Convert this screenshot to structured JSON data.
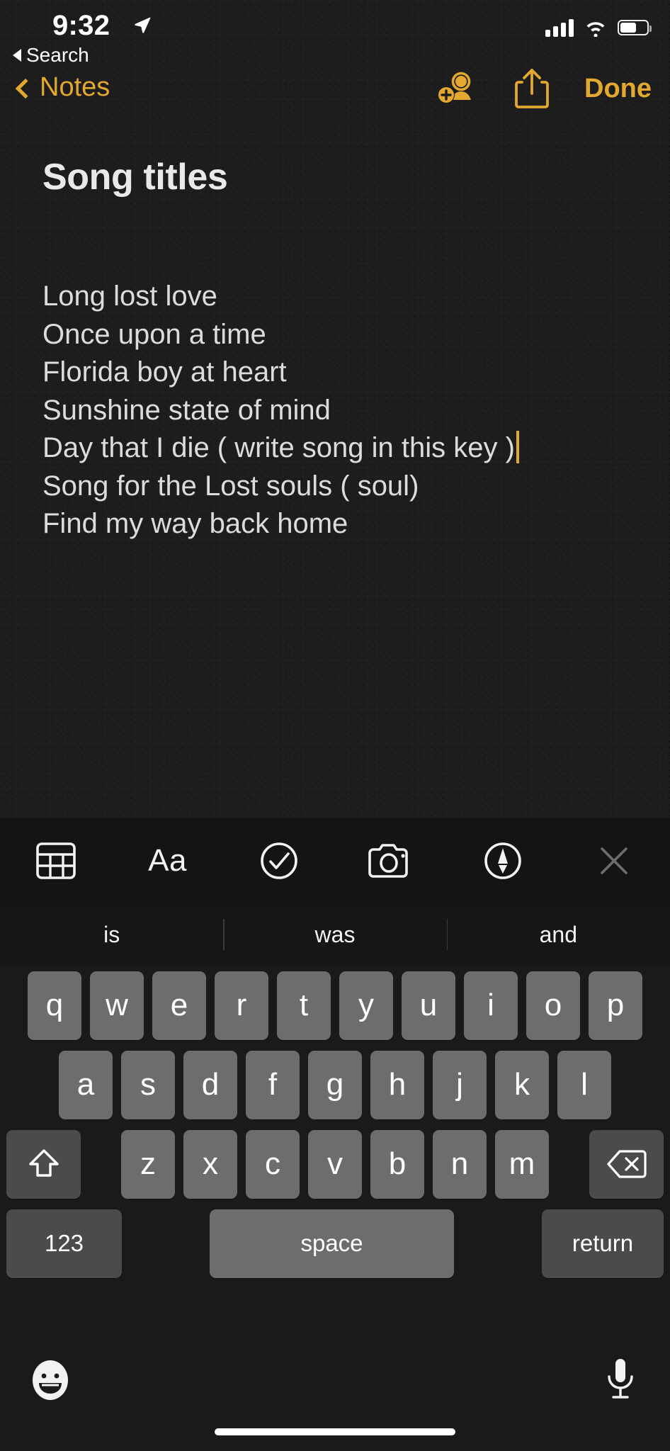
{
  "status_bar": {
    "time": "9:32",
    "location_icon": "location-arrow-icon",
    "cellular_icon": "cellular-signal-icon",
    "wifi_icon": "wifi-icon",
    "battery_icon": "battery-icon",
    "battery_level_pct": 62,
    "back_to_app_label": "Search",
    "back_to_app_icon": "triangle-left-icon"
  },
  "nav_bar": {
    "back_label": "Notes",
    "back_icon": "chevron-left-icon",
    "add_people_icon": "add-person-icon",
    "share_icon": "share-up-arrow-icon",
    "done_label": "Done",
    "accent_color": "#e3a82f"
  },
  "note": {
    "title": "Song titles",
    "lines": [
      "Long lost love",
      "Once upon a time",
      "Florida boy at heart",
      "Sunshine state of mind",
      "Day that I die ( write song in this key )",
      "Song for the Lost souls ( soul)",
      "Find my way back home"
    ],
    "caret_line_index": 4,
    "caret_color": "#e3a82f",
    "text_color": "#dcdcde",
    "background_color": "#1d1d1e"
  },
  "format_toolbar": {
    "items": [
      {
        "name": "table-icon",
        "label": ""
      },
      {
        "name": "format-aa-icon",
        "label": "Aa"
      },
      {
        "name": "checklist-circle-icon",
        "label": ""
      },
      {
        "name": "camera-icon",
        "label": ""
      },
      {
        "name": "markup-pen-icon",
        "label": ""
      },
      {
        "name": "close-x-icon",
        "label": ""
      }
    ]
  },
  "predictions": {
    "items": [
      "is",
      "was",
      "and"
    ]
  },
  "keyboard": {
    "row1": [
      "q",
      "w",
      "e",
      "r",
      "t",
      "y",
      "u",
      "i",
      "o",
      "p"
    ],
    "row2": [
      "a",
      "s",
      "d",
      "f",
      "g",
      "h",
      "j",
      "k",
      "l"
    ],
    "row3": [
      "z",
      "x",
      "c",
      "v",
      "b",
      "n",
      "m"
    ],
    "shift_icon": "shift-arrow-up-icon",
    "backspace_icon": "delete-left-icon",
    "numbers_label": "123",
    "space_label": "space",
    "return_label": "return",
    "emoji_icon": "emoji-smiley-icon",
    "dictation_icon": "microphone-icon",
    "key_color": "#6d6d70",
    "modifier_key_color": "#4b4b4e"
  }
}
